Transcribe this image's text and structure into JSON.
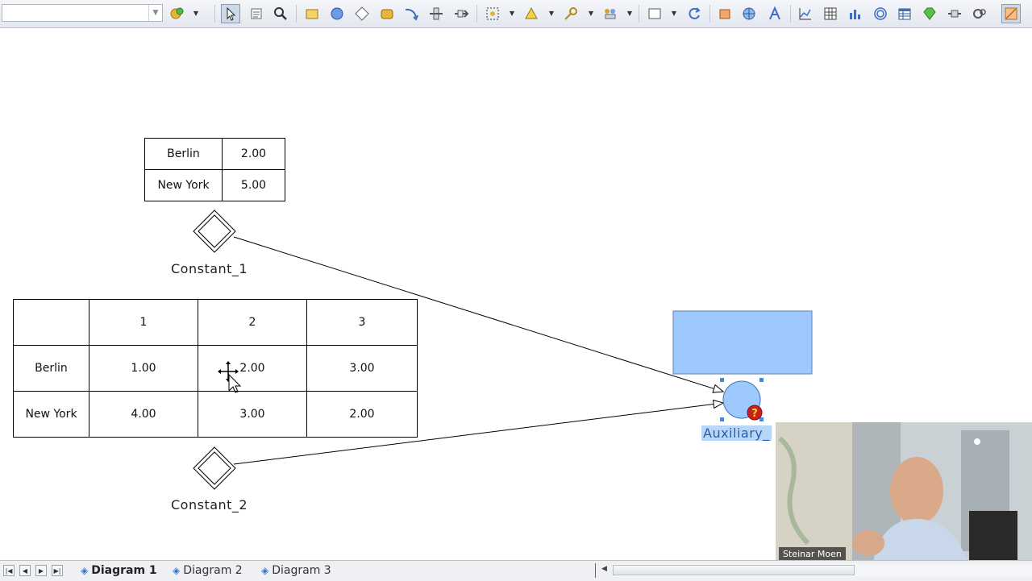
{
  "toolbar": {
    "combo_value": "",
    "icons": [
      "add-icon",
      "pointer-icon",
      "text-icon",
      "zoom-icon",
      "rectangle-icon",
      "circle-icon",
      "diamond-icon",
      "rounded-rect-icon",
      "curve-arrow-icon",
      "connector-icon",
      "link-icon",
      "lasso-icon",
      "triangle-icon",
      "key-icon",
      "group-icon",
      "selection-rect-icon",
      "refresh-icon",
      "hand-icon",
      "globe-icon",
      "font-icon",
      "chart-icon",
      "grid-icon",
      "bar-chart-icon",
      "spiral-icon",
      "table-icon",
      "gem-icon",
      "plug-icon",
      "gears-icon",
      "highlight-icon"
    ]
  },
  "diagram": {
    "constant1": {
      "label": "Constant_1",
      "rows": [
        [
          "Berlin",
          "2.00"
        ],
        [
          "New York",
          "5.00"
        ]
      ]
    },
    "constant2": {
      "label": "Constant_2",
      "headers": [
        "",
        "1",
        "2",
        "3"
      ],
      "rows": [
        [
          "Berlin",
          "1.00",
          "2.00",
          "3.00"
        ],
        [
          "New York",
          "4.00",
          "3.00",
          "2.00"
        ]
      ]
    },
    "auxiliary": {
      "label": "Auxiliary_",
      "fill": "#9ec9ff",
      "warning_glyph": "?"
    }
  },
  "tabs": [
    {
      "label": "Diagram 1",
      "active": true
    },
    {
      "label": "Diagram 2",
      "active": false
    },
    {
      "label": "Diagram 3",
      "active": false
    }
  ],
  "webcam": {
    "name": "Steinar Moen"
  }
}
